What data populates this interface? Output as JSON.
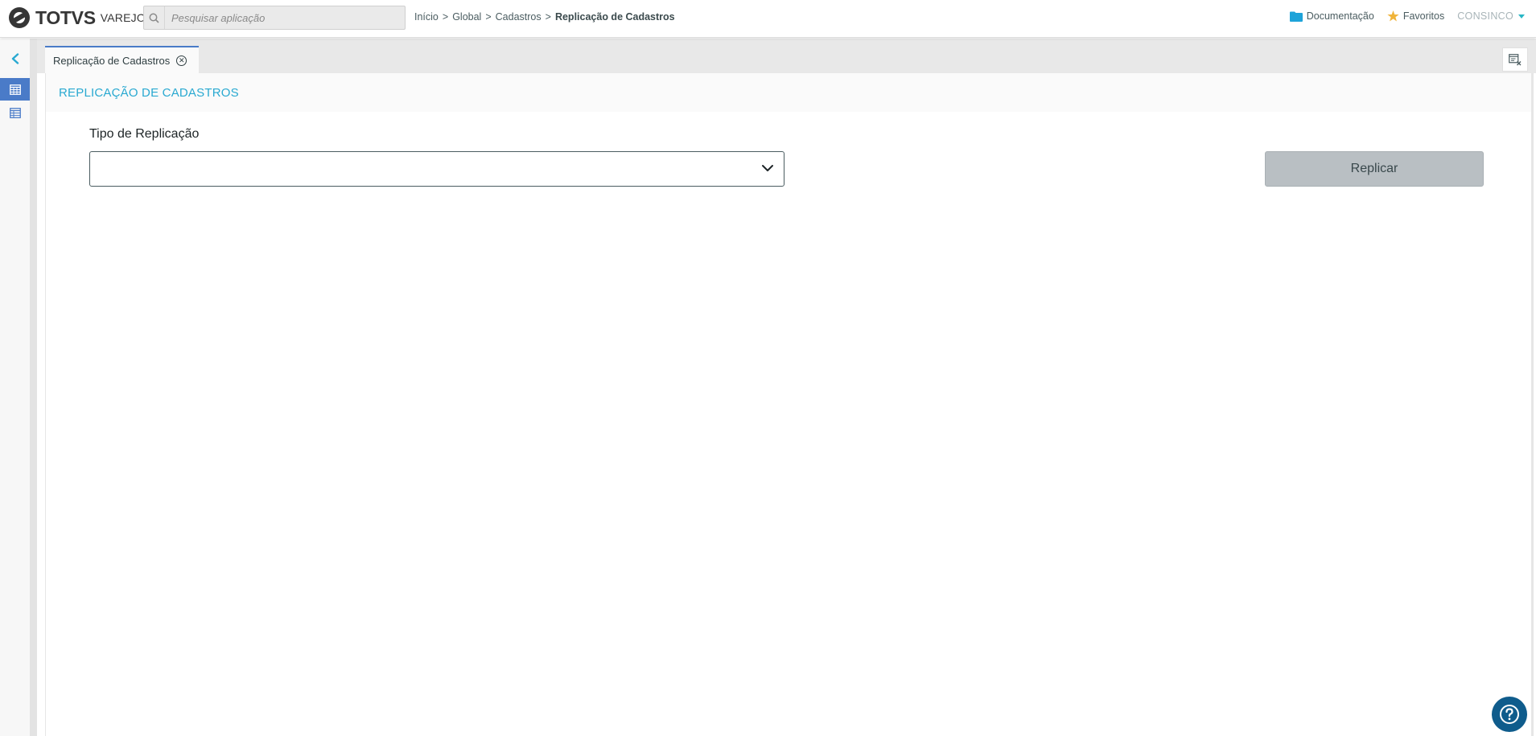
{
  "header": {
    "logo_text": "TOTVS",
    "logo_sub": "VAREJO",
    "search": {
      "placeholder": "Pesquisar aplicação",
      "value": ""
    },
    "breadcrumb": {
      "items": [
        "Início",
        "Global",
        "Cadastros"
      ],
      "separator": ">",
      "current": "Replicação de Cadastros"
    },
    "documentation_label": "Documentação",
    "favorites_label": "Favoritos",
    "user_label": "CONSINCO"
  },
  "sidebar": {
    "items": [
      {
        "icon": "calendar-grid-icon",
        "active": true
      },
      {
        "icon": "list-grid-icon",
        "active": false
      }
    ]
  },
  "tabs": [
    {
      "label": "Replicação de Cadastros",
      "active": true
    }
  ],
  "page": {
    "title": "REPLICAÇÃO DE CADASTROS",
    "field_label": "Tipo de Replicação",
    "select_value": "",
    "replicate_button": "Replicar"
  },
  "colors": {
    "accent": "#29a9d1",
    "active_blue": "#4a7bc8",
    "button_disabled": "#b9bfc3",
    "help_fab": "#0f5c8c",
    "folder": "#1ea3d9",
    "star": "#f0b43a"
  }
}
